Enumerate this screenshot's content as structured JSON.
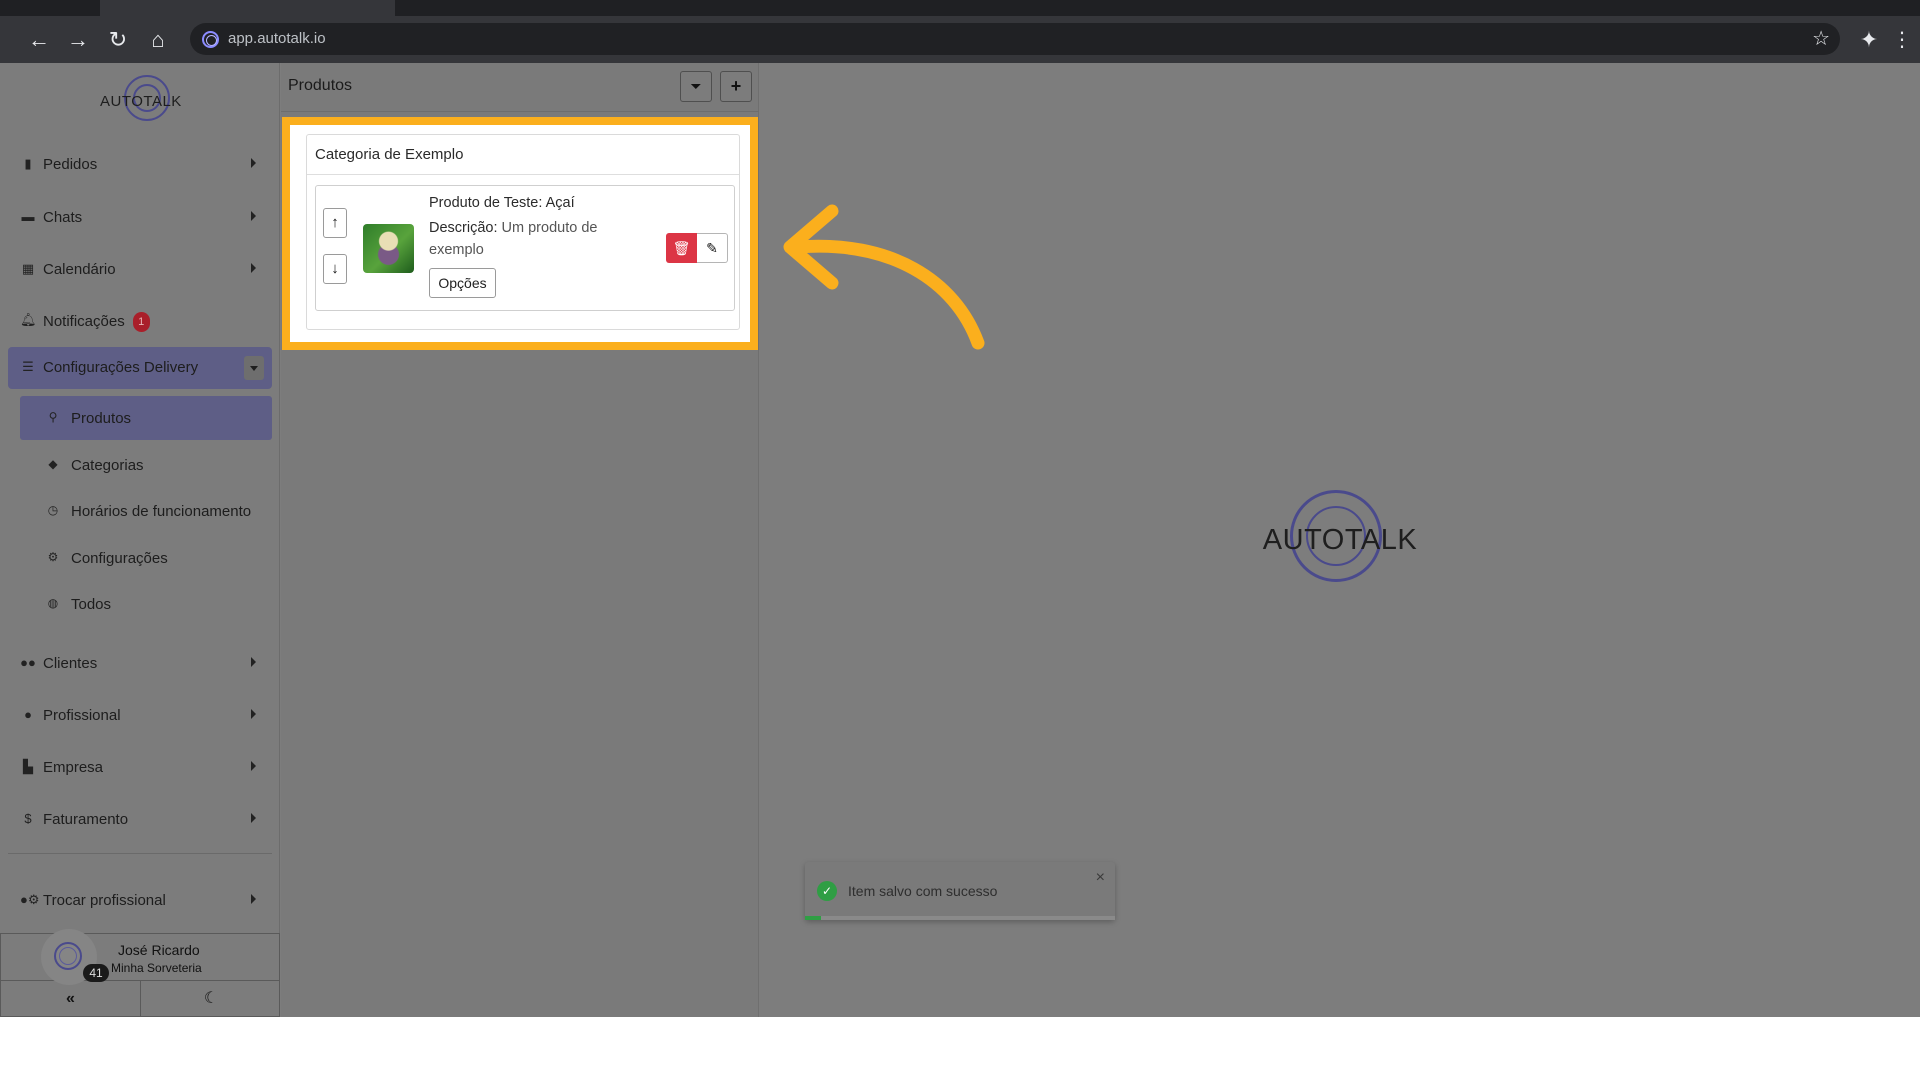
{
  "browser": {
    "url": "app.autotalk.io"
  },
  "brand": {
    "logo_text": "AUTOTALK"
  },
  "sidebar": {
    "items": [
      {
        "label": "Pedidos",
        "icon": "clipboard-icon"
      },
      {
        "label": "Chats",
        "icon": "chat-icon"
      },
      {
        "label": "Calendário",
        "icon": "calendar-icon"
      },
      {
        "label": "Notificações",
        "icon": "bell-icon",
        "badge": "1"
      },
      {
        "label": "Configurações Delivery",
        "icon": "sliders-icon"
      },
      {
        "label": "Clientes",
        "icon": "users-icon"
      },
      {
        "label": "Profissional",
        "icon": "user-tie-icon"
      },
      {
        "label": "Empresa",
        "icon": "building-icon"
      },
      {
        "label": "Faturamento",
        "icon": "dollar-icon"
      },
      {
        "label": "Trocar profissional",
        "icon": "users-cog-icon"
      }
    ],
    "subitems": [
      {
        "label": "Produtos",
        "icon": "ice-cream-icon"
      },
      {
        "label": "Categorias",
        "icon": "tag-icon"
      },
      {
        "label": "Horários de funcionamento",
        "icon": "clock-icon"
      },
      {
        "label": "Configurações",
        "icon": "gear-icon"
      },
      {
        "label": "Todos",
        "icon": "globe-icon"
      }
    ],
    "user": {
      "name": "José Ricardo",
      "company": "Minha Sorveteria",
      "count": "41"
    },
    "bottom": {
      "collapse": "«",
      "theme": "☾"
    }
  },
  "products": {
    "title": "Produtos",
    "filter_btn": "⏷",
    "add_btn": "+",
    "category_title": "Categoria de Exemplo",
    "item": {
      "name": "Produto de Teste: Açaí",
      "desc_label": "Descrição:",
      "desc_text": " Um produto de exemplo",
      "options_label": "Opções"
    }
  },
  "toast": {
    "message": "Item salvo com sucesso",
    "close": "×",
    "progress": 0.05
  },
  "colors": {
    "highlight": "#fbaf1d",
    "accent": "#5e5e86",
    "danger": "#dc3545",
    "success": "#2f9e44"
  }
}
